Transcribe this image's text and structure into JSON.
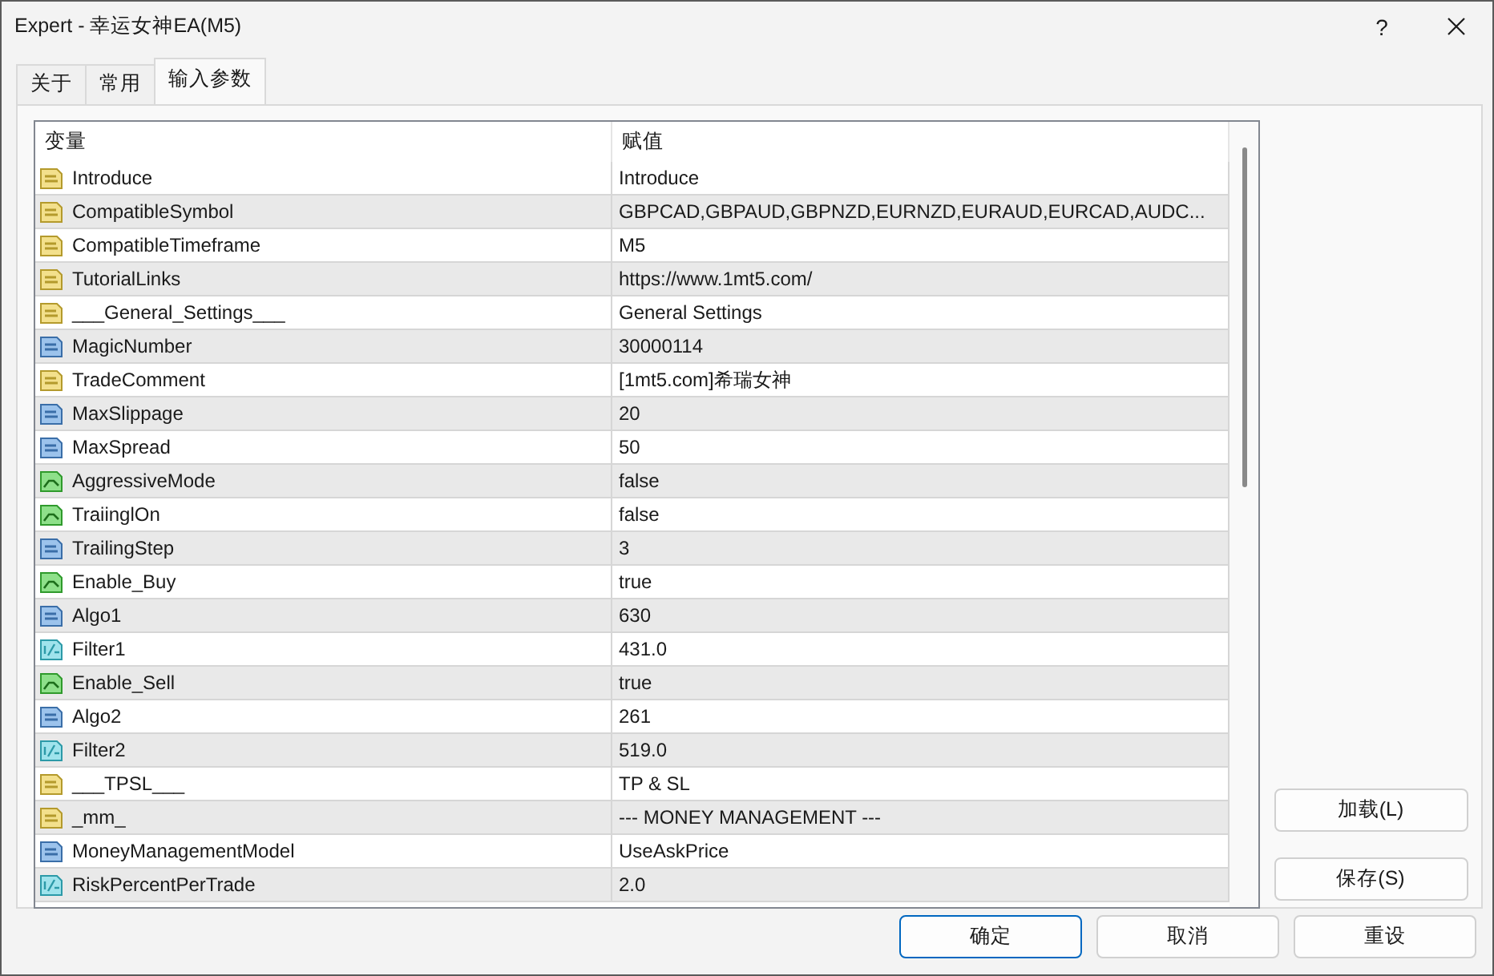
{
  "window": {
    "title": "Expert - 幸运女神EA(M5)",
    "help": "?"
  },
  "tabs": [
    {
      "label": "关于",
      "selected": false
    },
    {
      "label": "常用",
      "selected": false
    },
    {
      "label": "输入参数",
      "selected": true
    }
  ],
  "table": {
    "columns": [
      "变量",
      "赋值"
    ],
    "rows": [
      {
        "kind": "string",
        "name": "Introduce",
        "value": "Introduce"
      },
      {
        "kind": "string",
        "name": "CompatibleSymbol",
        "value": "GBPCAD,GBPAUD,GBPNZD,EURNZD,EURAUD,EURCAD,AUDC..."
      },
      {
        "kind": "string",
        "name": "CompatibleTimeframe",
        "value": "M5"
      },
      {
        "kind": "string",
        "name": "TutorialLinks",
        "value": "https://www.1mt5.com/"
      },
      {
        "kind": "string",
        "name": "___General_Settings___",
        "value": "General Settings"
      },
      {
        "kind": "integer",
        "name": "MagicNumber",
        "value": "30000114"
      },
      {
        "kind": "string",
        "name": "TradeComment",
        "value": "[1mt5.com]希瑞女神"
      },
      {
        "kind": "integer",
        "name": "MaxSlippage",
        "value": "20"
      },
      {
        "kind": "integer",
        "name": "MaxSpread",
        "value": "50"
      },
      {
        "kind": "boolean",
        "name": "AggressiveMode",
        "value": "false"
      },
      {
        "kind": "boolean",
        "name": "TraiinglOn",
        "value": "false"
      },
      {
        "kind": "integer",
        "name": "TrailingStep",
        "value": "3"
      },
      {
        "kind": "boolean",
        "name": "Enable_Buy",
        "value": "true"
      },
      {
        "kind": "integer",
        "name": "Algo1",
        "value": "630"
      },
      {
        "kind": "double",
        "name": "Filter1",
        "value": "431.0"
      },
      {
        "kind": "boolean",
        "name": "Enable_Sell",
        "value": "true"
      },
      {
        "kind": "integer",
        "name": "Algo2",
        "value": "261"
      },
      {
        "kind": "double",
        "name": "Filter2",
        "value": "519.0"
      },
      {
        "kind": "string",
        "name": "___TPSL___",
        "value": "TP & SL"
      },
      {
        "kind": "string",
        "name": "_mm_",
        "value": "--- MONEY MANAGEMENT ---"
      },
      {
        "kind": "integer",
        "name": "MoneyManagementModel",
        "value": "UseAskPrice"
      },
      {
        "kind": "double",
        "name": "RiskPercentPerTrade",
        "value": "2.0"
      }
    ]
  },
  "side_buttons": [
    "加载(L)",
    "保存(S)"
  ],
  "buttons": [
    {
      "label": "确定",
      "default": true
    },
    {
      "label": "取消",
      "default": false
    },
    {
      "label": "重设",
      "default": false
    }
  ]
}
